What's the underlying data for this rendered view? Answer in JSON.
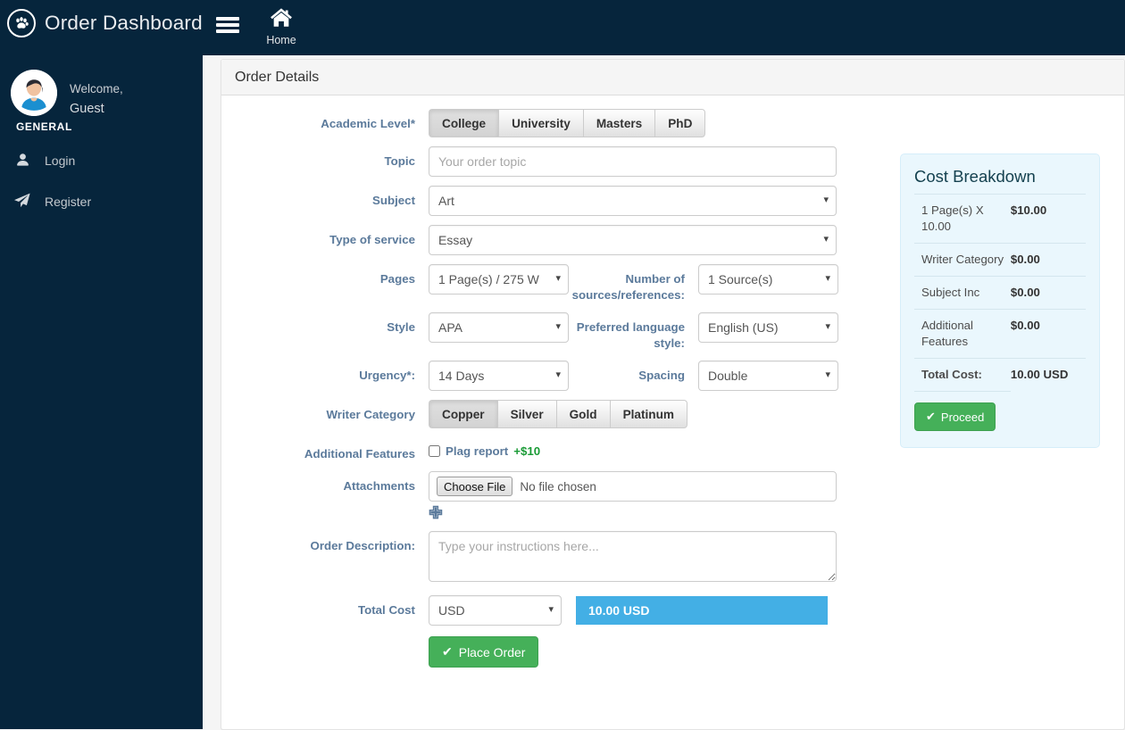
{
  "header": {
    "brand_title": "Order Dashboard",
    "logo_icon": "paw-circle-icon",
    "menu_icon": "hamburger-icon",
    "home_label": "Home",
    "home_icon": "home-icon"
  },
  "sidebar": {
    "welcome_text": "Welcome,",
    "user_name": "Guest",
    "section_label": "GENERAL",
    "avatar_icon": "user-avatar",
    "items": [
      {
        "label": "Login",
        "icon": "user-icon"
      },
      {
        "label": "Register",
        "icon": "paper-plane-icon"
      }
    ]
  },
  "panel": {
    "title": "Order Details"
  },
  "form": {
    "academic_level": {
      "label": "Academic Level*",
      "options": [
        "College",
        "University",
        "Masters",
        "PhD"
      ],
      "selected": "College"
    },
    "topic": {
      "label": "Topic",
      "placeholder": "Your order topic",
      "value": ""
    },
    "subject": {
      "label": "Subject",
      "value": "Art"
    },
    "type_of_service": {
      "label": "Type of service",
      "value": "Essay"
    },
    "pages": {
      "label": "Pages",
      "value": "1 Page(s) / 275 W"
    },
    "sources": {
      "label": "Number of sources/references:",
      "value": "1 Source(s)"
    },
    "style": {
      "label": "Style",
      "value": "APA"
    },
    "language_style": {
      "label": "Preferred language style:",
      "value": "English (US)"
    },
    "urgency": {
      "label": "Urgency*:",
      "value": "14 Days"
    },
    "spacing": {
      "label": "Spacing",
      "value": "Double"
    },
    "writer_category": {
      "label": "Writer Category",
      "options": [
        "Copper",
        "Silver",
        "Gold",
        "Platinum"
      ],
      "selected": "Copper"
    },
    "additional_features": {
      "label": "Additional Features",
      "checkbox_label": "Plag report",
      "checkbox_price": "+$10",
      "checked": false
    },
    "attachments": {
      "label": "Attachments",
      "button_label": "Choose File",
      "file_status": "No file chosen",
      "add_icon": "plus-icon"
    },
    "order_description": {
      "label": "Order Description:",
      "placeholder": "Type your instructions here...",
      "value": ""
    },
    "total_cost": {
      "label": "Total Cost",
      "currency": "USD",
      "amount_display": "10.00 USD"
    },
    "place_order": {
      "label": "Place Order",
      "icon": "check-icon"
    }
  },
  "cost_breakdown": {
    "title": "Cost Breakdown",
    "rows": [
      {
        "label": "1 Page(s) X 10.00",
        "amount": "$10.00"
      },
      {
        "label": "Writer Category",
        "amount": "$0.00"
      },
      {
        "label": "Subject Inc",
        "amount": "$0.00"
      },
      {
        "label": "Additional Features",
        "amount": "$0.00"
      }
    ],
    "total_label": "Total Cost:",
    "total_amount": "10.00 USD",
    "proceed_label": "Proceed",
    "proceed_icon": "check-icon"
  },
  "colors": {
    "navy": "#06253c",
    "accent_blue": "#43afe5",
    "green": "#45b059",
    "label_blue": "#5b7a9b",
    "card_bg": "#eaf7fd",
    "price_green": "#1a9b36"
  }
}
